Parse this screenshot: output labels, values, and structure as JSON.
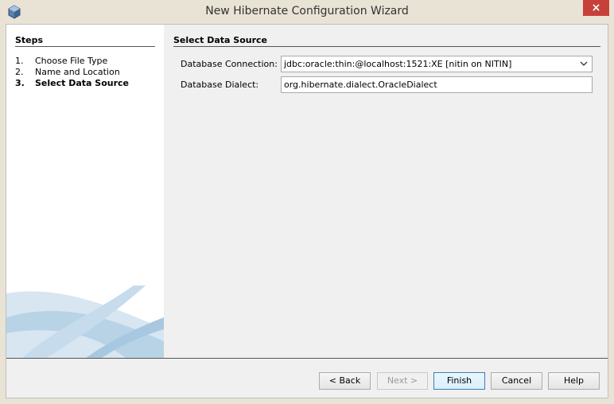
{
  "window": {
    "title": "New Hibernate Configuration Wizard",
    "close_label": "×"
  },
  "steps": {
    "title": "Steps",
    "items": [
      {
        "num": "1.",
        "label": "Choose File Type"
      },
      {
        "num": "2.",
        "label": "Name and Location"
      },
      {
        "num": "3.",
        "label": "Select Data Source",
        "current": true
      }
    ]
  },
  "panel": {
    "title": "Select Data Source",
    "db_connection_label": "Database Connection:",
    "db_connection_value": "jdbc:oracle:thin:@localhost:1521:XE [nitin on NITIN]",
    "db_dialect_label": "Database Dialect:",
    "db_dialect_value": "org.hibernate.dialect.OracleDialect"
  },
  "buttons": {
    "back": "< Back",
    "next": "Next >",
    "finish": "Finish",
    "cancel": "Cancel",
    "help": "Help"
  },
  "colors": {
    "close_button": "#c7413a",
    "window_frame": "#e9e3d6",
    "decor_blue": "#b9d3e6"
  }
}
